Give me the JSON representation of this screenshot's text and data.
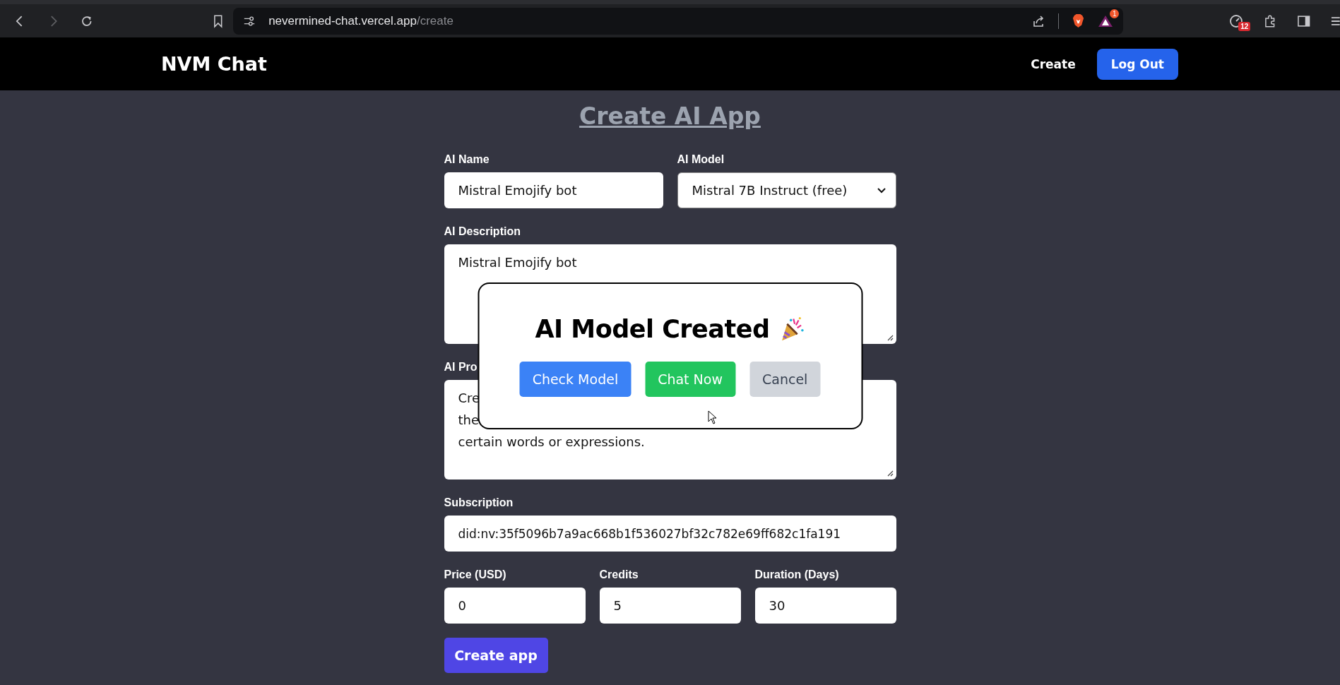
{
  "browser": {
    "url_host": "nevermined-chat.vercel.app",
    "url_path": "/create",
    "forward_disabled": true,
    "extension_badges": [
      "1",
      "12"
    ]
  },
  "navbar": {
    "brand": "NVM Chat",
    "links": [
      {
        "label": "Create",
        "kind": "link"
      },
      {
        "label": "Log Out",
        "kind": "button"
      }
    ]
  },
  "page_title": "Create AI App",
  "form": {
    "rows": [
      {
        "fields": [
          {
            "label": "AI Name",
            "kind": "text",
            "value": "Mistral Emojify bot"
          },
          {
            "label": "AI Model",
            "kind": "select",
            "value": "Mistral 7B Instruct (free)"
          }
        ]
      },
      {
        "fields": [
          {
            "label": "AI Description",
            "kind": "textarea",
            "lines": [
              "Mistral Emojify bot"
            ]
          }
        ]
      },
      {
        "fields": [
          {
            "label": "AI Pro",
            "kind": "textarea",
            "lines": [
              "Cre",
              "the",
              "certain words or expressions."
            ]
          }
        ]
      },
      {
        "fields": [
          {
            "label": "Subscription",
            "kind": "text",
            "value": "did:nv:35f5096b7a9ac668b1f536027bf32c782e69ff682c1fa191"
          }
        ]
      },
      {
        "fields": [
          {
            "label": "Price (USD)",
            "kind": "text",
            "value": "0"
          },
          {
            "label": "Credits",
            "kind": "text",
            "value": "5"
          },
          {
            "label": "Duration (Days)",
            "kind": "text",
            "value": "30"
          }
        ]
      }
    ],
    "submit": "Create app"
  },
  "modal": {
    "title": "AI Model Created",
    "buttons": [
      {
        "label": "Check Model",
        "kind": "primary"
      },
      {
        "label": "Chat Now",
        "kind": "success"
      },
      {
        "label": "Cancel",
        "kind": "secondary"
      }
    ]
  }
}
